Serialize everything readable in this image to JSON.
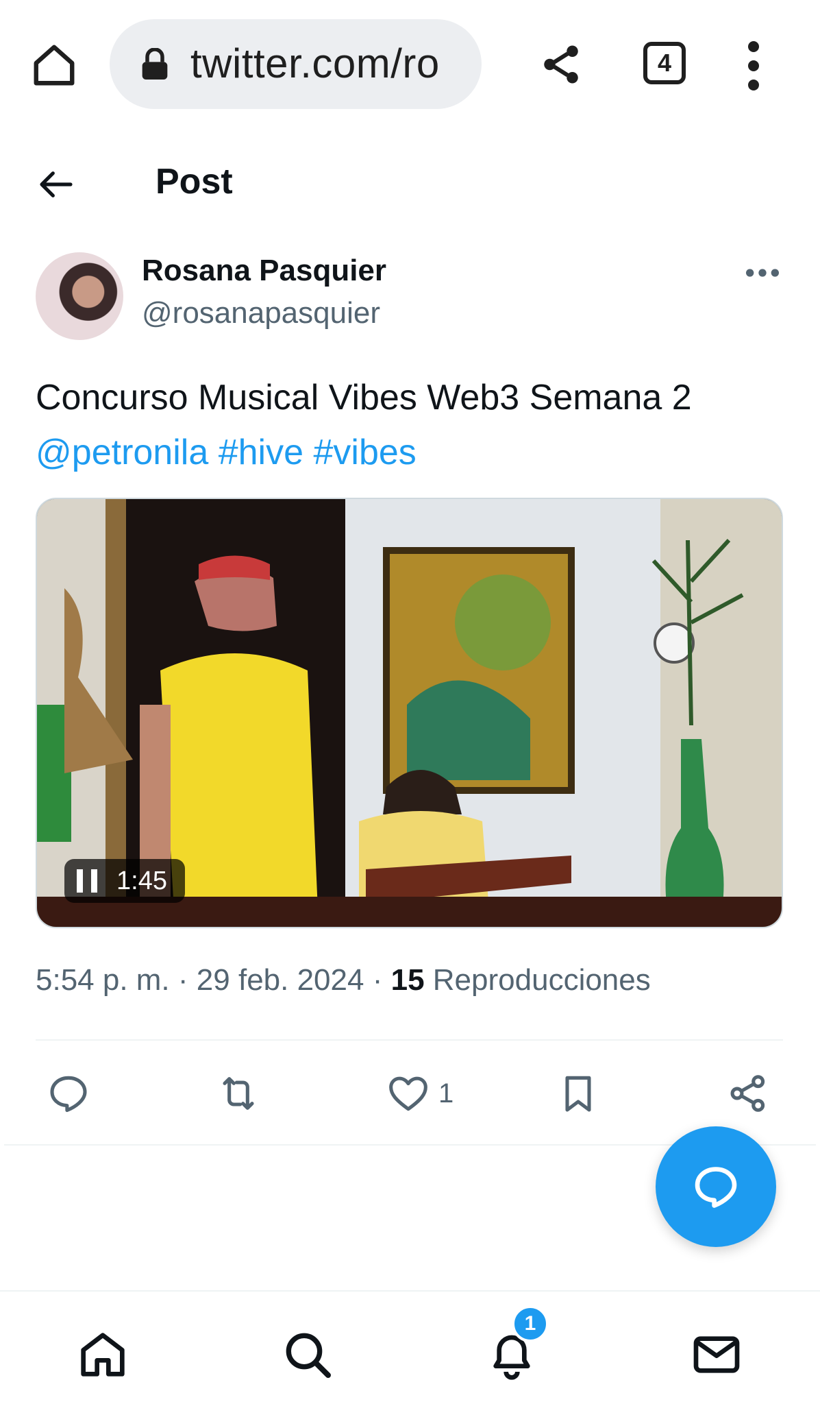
{
  "browser": {
    "url": "twitter.com/ro",
    "tab_count": "4",
    "icons": [
      "home-icon",
      "lock-icon",
      "share-icon",
      "tabs-icon",
      "more-vert-icon"
    ]
  },
  "header": {
    "title": "Post",
    "back_icon": "arrow-left-icon"
  },
  "post": {
    "author_name": "Rosana Pasquier",
    "author_handle": "@rosanapasquier",
    "text_line1": "Concurso Musical Vibes Web3 Semana 2",
    "mention": "@petronila",
    "hashtags": [
      "#hive",
      "#vibes"
    ],
    "video": {
      "time_remaining": "1:45",
      "state": "playing"
    },
    "time": "5:54 p. m.",
    "sep": "·",
    "date": "29 feb. 2024",
    "views_count": "15",
    "views_label": "Reproducciones"
  },
  "actions": {
    "likes": "1",
    "icons": [
      "reply-icon",
      "retweet-icon",
      "like-icon",
      "bookmark-icon",
      "share-icon"
    ]
  },
  "bottom_nav": {
    "notifications_badge": "1",
    "icons": [
      "home-icon",
      "search-icon",
      "bell-icon",
      "mail-icon"
    ]
  },
  "colors": {
    "accent": "#1d9bf0",
    "text": "#0f1419",
    "secondary": "#536471",
    "urlbar": "#eceef1"
  }
}
